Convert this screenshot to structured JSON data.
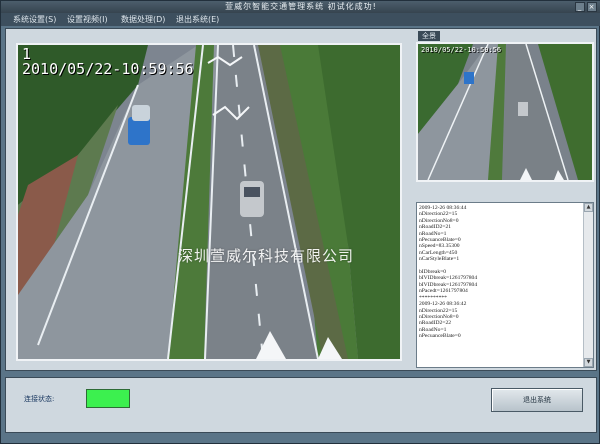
{
  "window": {
    "title": "萱威尔智能交通管理系统 初试化成功!",
    "minimize_glyph": "_",
    "close_glyph": "×"
  },
  "menu": {
    "items": [
      {
        "label": "系统设置(S)"
      },
      {
        "label": "设置视频(I)"
      },
      {
        "label": "数据处理(D)"
      },
      {
        "label": "退出系统(E)"
      }
    ]
  },
  "video": {
    "channel": "1",
    "timestamp": "2010/05/22-10:59:56"
  },
  "thumbnail": {
    "label": "全景",
    "timestamp": "2010/05/22-10:59:56"
  },
  "log": {
    "lines": [
      "2009-12-26 08:36:44",
      "nDirection22=15",
      "nDirectionNo8=0",
      "nRoadID2=21",
      "nRoadNo=1",
      "nPecuanceBlate=0",
      "nSpeed=83.35300",
      "nCarLength=450",
      "nCarStyleBlate=1",
      "",
      "bIDbreak=0",
      "bIVIDbreak=1261797804",
      "bIVIDbreak=1261797804",
      "nPacedt=1261797804",
      "**********",
      "2009-12-26 08:36:42",
      "nDirection22=15",
      "nDirectionNo8=0",
      "nRoadID2=22",
      "nRoadNo=1",
      "nPecuanceBlate=0"
    ],
    "scroll_up": "▲",
    "scroll_down": "▼"
  },
  "watermark": "深圳萱威尔科技有限公司",
  "status": {
    "label": "连接状态:",
    "led_color": "#3cf04f"
  },
  "exit_button": {
    "label": "退出系统"
  }
}
